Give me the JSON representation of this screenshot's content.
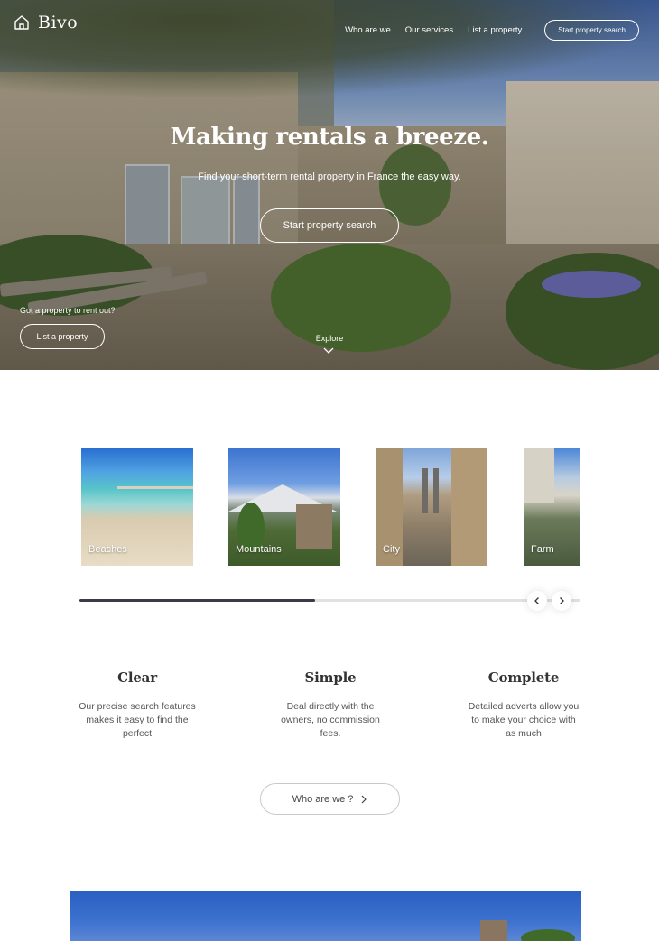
{
  "brand": {
    "name": "Bivo"
  },
  "nav": {
    "items": [
      "Who are we",
      "Our services",
      "List a property"
    ],
    "cta": "Start property search"
  },
  "hero": {
    "title": "Making rentals a breeze.",
    "subtitle": "Find your short-term rental property in France the easy way.",
    "cta": "Start property search",
    "rent_question": "Got a property to rent out?",
    "rent_button": "List a property",
    "explore": "Explore"
  },
  "categories": [
    "Beaches",
    "Mountains",
    "City",
    "Farm"
  ],
  "carousel": {
    "progress": 0.47
  },
  "features": [
    {
      "title": "Clear",
      "text": "Our precise search features makes it easy to find the perfect"
    },
    {
      "title": "Simple",
      "text": "Deal directly with the owners, no commission fees."
    },
    {
      "title": "Complete",
      "text": "Detailed adverts allow you to make your choice with as much"
    }
  ],
  "who_button": "Who are we ?",
  "colors": {
    "accent": "#3b3a4a",
    "text": "#3a3a3a"
  },
  "icons": {
    "logo": "house-outline-icon",
    "explore": "chevron-down-icon",
    "prev": "chevron-left-icon",
    "next": "chevron-right-icon"
  }
}
